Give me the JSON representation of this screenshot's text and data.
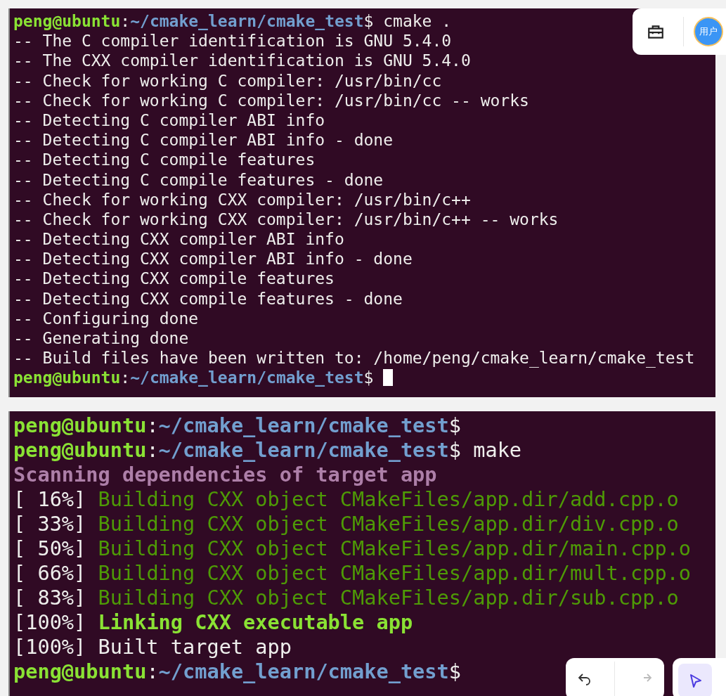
{
  "terminals": [
    {
      "lines": [
        {
          "cursor": false,
          "segments": [
            {
              "kind": "user",
              "text": "peng@ubuntu"
            },
            {
              "kind": "plain",
              "text": ":"
            },
            {
              "kind": "path",
              "text": "~/cmake_learn/cmake_test"
            },
            {
              "kind": "plain",
              "text": "$ cmake ."
            }
          ]
        },
        {
          "cursor": false,
          "segments": [
            {
              "kind": "plain",
              "text": "-- The C compiler identification is GNU 5.4.0"
            }
          ]
        },
        {
          "cursor": false,
          "segments": [
            {
              "kind": "plain",
              "text": "-- The CXX compiler identification is GNU 5.4.0"
            }
          ]
        },
        {
          "cursor": false,
          "segments": [
            {
              "kind": "plain",
              "text": "-- Check for working C compiler: /usr/bin/cc"
            }
          ]
        },
        {
          "cursor": false,
          "segments": [
            {
              "kind": "plain",
              "text": "-- Check for working C compiler: /usr/bin/cc -- works"
            }
          ]
        },
        {
          "cursor": false,
          "segments": [
            {
              "kind": "plain",
              "text": "-- Detecting C compiler ABI info"
            }
          ]
        },
        {
          "cursor": false,
          "segments": [
            {
              "kind": "plain",
              "text": "-- Detecting C compiler ABI info - done"
            }
          ]
        },
        {
          "cursor": false,
          "segments": [
            {
              "kind": "plain",
              "text": "-- Detecting C compile features"
            }
          ]
        },
        {
          "cursor": false,
          "segments": [
            {
              "kind": "plain",
              "text": "-- Detecting C compile features - done"
            }
          ]
        },
        {
          "cursor": false,
          "segments": [
            {
              "kind": "plain",
              "text": "-- Check for working CXX compiler: /usr/bin/c++"
            }
          ]
        },
        {
          "cursor": false,
          "segments": [
            {
              "kind": "plain",
              "text": "-- Check for working CXX compiler: /usr/bin/c++ -- works"
            }
          ]
        },
        {
          "cursor": false,
          "segments": [
            {
              "kind": "plain",
              "text": "-- Detecting CXX compiler ABI info"
            }
          ]
        },
        {
          "cursor": false,
          "segments": [
            {
              "kind": "plain",
              "text": "-- Detecting CXX compiler ABI info - done"
            }
          ]
        },
        {
          "cursor": false,
          "segments": [
            {
              "kind": "plain",
              "text": "-- Detecting CXX compile features"
            }
          ]
        },
        {
          "cursor": false,
          "segments": [
            {
              "kind": "plain",
              "text": "-- Detecting CXX compile features - done"
            }
          ]
        },
        {
          "cursor": false,
          "segments": [
            {
              "kind": "plain",
              "text": "-- Configuring done"
            }
          ]
        },
        {
          "cursor": false,
          "segments": [
            {
              "kind": "plain",
              "text": "-- Generating done"
            }
          ]
        },
        {
          "cursor": false,
          "segments": [
            {
              "kind": "plain",
              "text": "-- Build files have been written to: /home/peng/cmake_learn/cmake_test"
            }
          ]
        },
        {
          "cursor": true,
          "segments": [
            {
              "kind": "user",
              "text": "peng@ubuntu"
            },
            {
              "kind": "plain",
              "text": ":"
            },
            {
              "kind": "path",
              "text": "~/cmake_learn/cmake_test"
            },
            {
              "kind": "plain",
              "text": "$"
            }
          ]
        }
      ]
    },
    {
      "lines": [
        {
          "cursor": false,
          "segments": [
            {
              "kind": "user",
              "text": "peng@ubuntu"
            },
            {
              "kind": "plain",
              "text": ":"
            },
            {
              "kind": "path",
              "text": "~/cmake_learn/cmake_test"
            },
            {
              "kind": "plain",
              "text": "$"
            }
          ]
        },
        {
          "cursor": false,
          "segments": [
            {
              "kind": "user",
              "text": "peng@ubuntu"
            },
            {
              "kind": "plain",
              "text": ":"
            },
            {
              "kind": "path",
              "text": "~/cmake_learn/cmake_test"
            },
            {
              "kind": "plain",
              "text": "$ make"
            }
          ]
        },
        {
          "cursor": false,
          "segments": [
            {
              "kind": "scan",
              "text": "Scanning dependencies of target app"
            }
          ]
        },
        {
          "cursor": false,
          "segments": [
            {
              "kind": "plain",
              "text": "[ 16%] "
            },
            {
              "kind": "build",
              "text": "Building CXX object CMakeFiles/app.dir/add.cpp.o"
            }
          ]
        },
        {
          "cursor": false,
          "segments": [
            {
              "kind": "plain",
              "text": "[ 33%] "
            },
            {
              "kind": "build",
              "text": "Building CXX object CMakeFiles/app.dir/div.cpp.o"
            }
          ]
        },
        {
          "cursor": false,
          "segments": [
            {
              "kind": "plain",
              "text": "[ 50%] "
            },
            {
              "kind": "build",
              "text": "Building CXX object CMakeFiles/app.dir/main.cpp.o"
            }
          ]
        },
        {
          "cursor": false,
          "segments": [
            {
              "kind": "plain",
              "text": "[ 66%] "
            },
            {
              "kind": "build",
              "text": "Building CXX object CMakeFiles/app.dir/mult.cpp.o"
            }
          ]
        },
        {
          "cursor": false,
          "segments": [
            {
              "kind": "plain",
              "text": "[ 83%] "
            },
            {
              "kind": "build",
              "text": "Building CXX object CMakeFiles/app.dir/sub.cpp.o"
            }
          ]
        },
        {
          "cursor": false,
          "segments": [
            {
              "kind": "plain",
              "text": "[100%] "
            },
            {
              "kind": "link",
              "text": "Linking CXX executable app"
            }
          ]
        },
        {
          "cursor": false,
          "segments": [
            {
              "kind": "plain",
              "text": "[100%] Built target app"
            }
          ]
        },
        {
          "cursor": false,
          "segments": [
            {
              "kind": "user",
              "text": "peng@ubuntu"
            },
            {
              "kind": "plain",
              "text": ":"
            },
            {
              "kind": "path",
              "text": "~/cmake_learn/cmake_test"
            },
            {
              "kind": "plain",
              "text": "$"
            }
          ]
        }
      ]
    }
  ],
  "avatar": {
    "text": "用户"
  },
  "pointer_tool": {
    "selected": true
  }
}
